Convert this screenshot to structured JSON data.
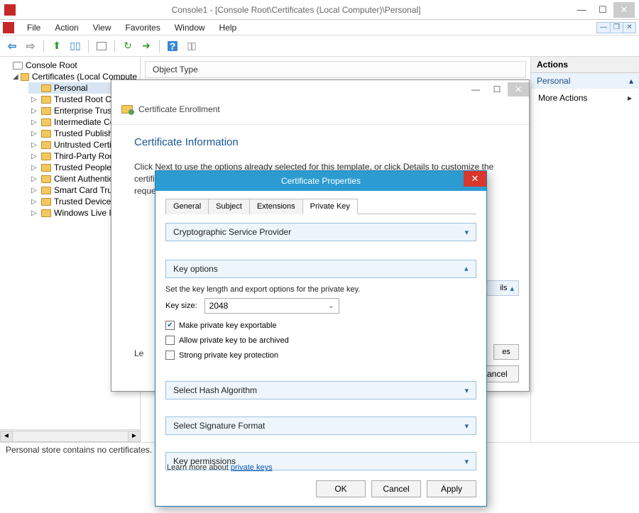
{
  "window": {
    "title": "Console1 - [Console Root\\Certificates (Local Computer)\\Personal]"
  },
  "menu": {
    "items": [
      "File",
      "Action",
      "View",
      "Favorites",
      "Window",
      "Help"
    ]
  },
  "tree": {
    "root": "Console Root",
    "certs_node": "Certificates (Local Compute",
    "children": [
      "Personal",
      "Trusted Root Ce",
      "Enterprise Trust",
      "Intermediate Cer",
      "Trusted Publishe",
      "Untrusted Certifi",
      "Third-Party Root",
      "Trusted People",
      "Client Authentic",
      "Smart Card Trust",
      "Trusted Devices",
      "Windows Live ID"
    ]
  },
  "center": {
    "column_header": "Object Type"
  },
  "actions": {
    "title": "Actions",
    "section": "Personal",
    "more": "More Actions"
  },
  "status": "Personal store contains no certificates.",
  "enrollment": {
    "title": "Certificate Enrollment",
    "heading": "Certificate Information",
    "desc1": "Click Next to use the options already selected for this template, or click Details to customize the certificate",
    "desc2": "request.",
    "details_label": "ils",
    "props_btn": "es",
    "learn_prefix": "Le",
    "cancel": "Cancel"
  },
  "properties": {
    "title": "Certificate Properties",
    "tabs": [
      "General",
      "Subject",
      "Extensions",
      "Private Key"
    ],
    "csp": "Cryptographic Service Provider",
    "key_options": "Key options",
    "key_options_desc": "Set the key length and export options for the private key.",
    "key_size_label": "Key size:",
    "key_size_value": "2048",
    "cb_exportable": "Make private key exportable",
    "cb_archive": "Allow private key to be archived",
    "cb_strong": "Strong private key protection",
    "hash": "Select Hash Algorithm",
    "sig": "Select Signature Format",
    "perm": "Key permissions",
    "learn_text": "Learn more about ",
    "learn_link": "private keys",
    "ok": "OK",
    "cancel": "Cancel",
    "apply": "Apply"
  }
}
